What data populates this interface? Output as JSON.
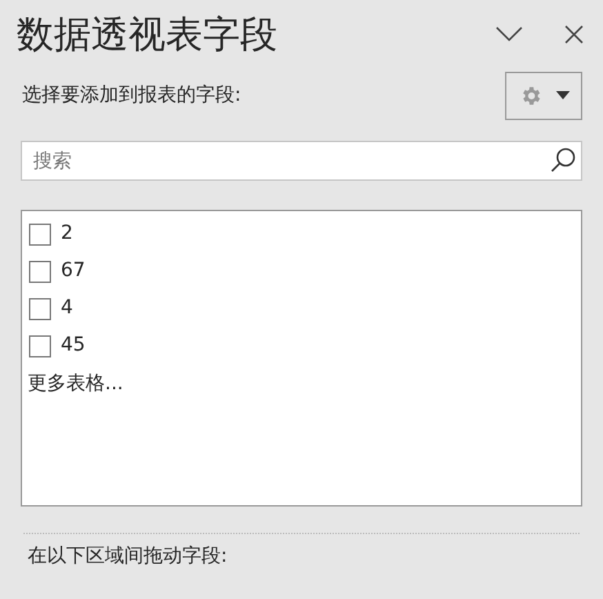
{
  "pane": {
    "title": "数据透视表字段"
  },
  "prompt": "选择要添加到报表的字段:",
  "search": {
    "placeholder": "搜索"
  },
  "fields": [
    {
      "label": "2",
      "checked": false
    },
    {
      "label": "67",
      "checked": false
    },
    {
      "label": "4",
      "checked": false
    },
    {
      "label": "45",
      "checked": false
    }
  ],
  "more_tables": "更多表格...",
  "areas_prompt": "在以下区域间拖动字段:"
}
